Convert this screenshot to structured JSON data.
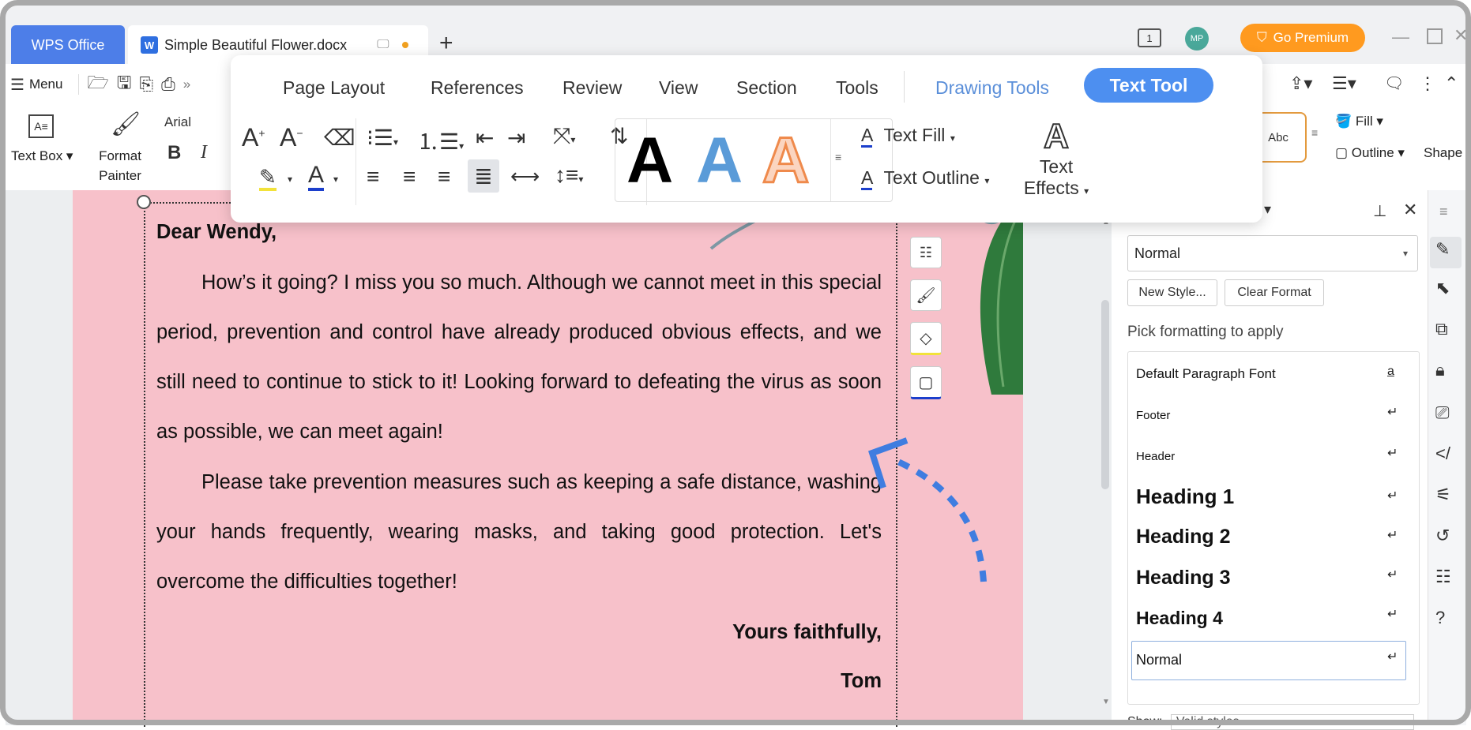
{
  "titlebar": {
    "app_tab": "WPS Office",
    "doc_tab": "Simple Beautiful Flower.docx",
    "new_tab": "+",
    "avatar_initials": "MP",
    "premium_label": "Go Premium"
  },
  "ribbon": {
    "menu_label": "Menu",
    "text_box_label": "Text Box",
    "format_painter_line1": "Format",
    "format_painter_line2": "Painter",
    "font_name": "Arial",
    "bold": "B",
    "italic": "I",
    "fill_label": "Fill",
    "outline_label": "Outline",
    "shape_label": "Shape",
    "abc": "Abc"
  },
  "float_toolbar": {
    "tabs": [
      "Page Layout",
      "References",
      "Review",
      "View",
      "Section",
      "Tools"
    ],
    "drawing_tools": "Drawing Tools",
    "text_tool": "Text Tool",
    "text_fill": "Text Fill",
    "text_outline": "Text Outline",
    "text_effects_line1": "Text",
    "text_effects_line2": "Effects",
    "style_letters": [
      "A",
      "A",
      "A"
    ]
  },
  "document": {
    "salutation": "Dear Wendy,",
    "para1": "How’s it going? I miss you so much. Although we cannot meet in this special period, prevention and control have already produced obvious effects, and we still need to continue to stick to it! Looking forward to defeating the virus as soon as possible, we can meet again!",
    "para2": "Please take prevention measures such as keeping a safe distance, washing your hands frequently, wearing masks, and taking good protection. Let's overcome the difficulties together!",
    "closing": "Yours faithfully,",
    "signature": "Tom"
  },
  "styles_panel": {
    "current_style": "Normal",
    "new_style": "New Style...",
    "clear_format": "Clear Format",
    "pick_label": "Pick formatting to apply",
    "items": [
      "Default Paragraph Font",
      "Footer",
      "Header",
      "Heading 1",
      "Heading 2",
      "Heading 3",
      "Heading 4",
      "Normal"
    ],
    "show_label": "Show:",
    "show_value": "Valid styles"
  },
  "colors": {
    "accent": "#4d8ff0",
    "page": "#f7c1ca",
    "premium": "#ff9a1f"
  }
}
